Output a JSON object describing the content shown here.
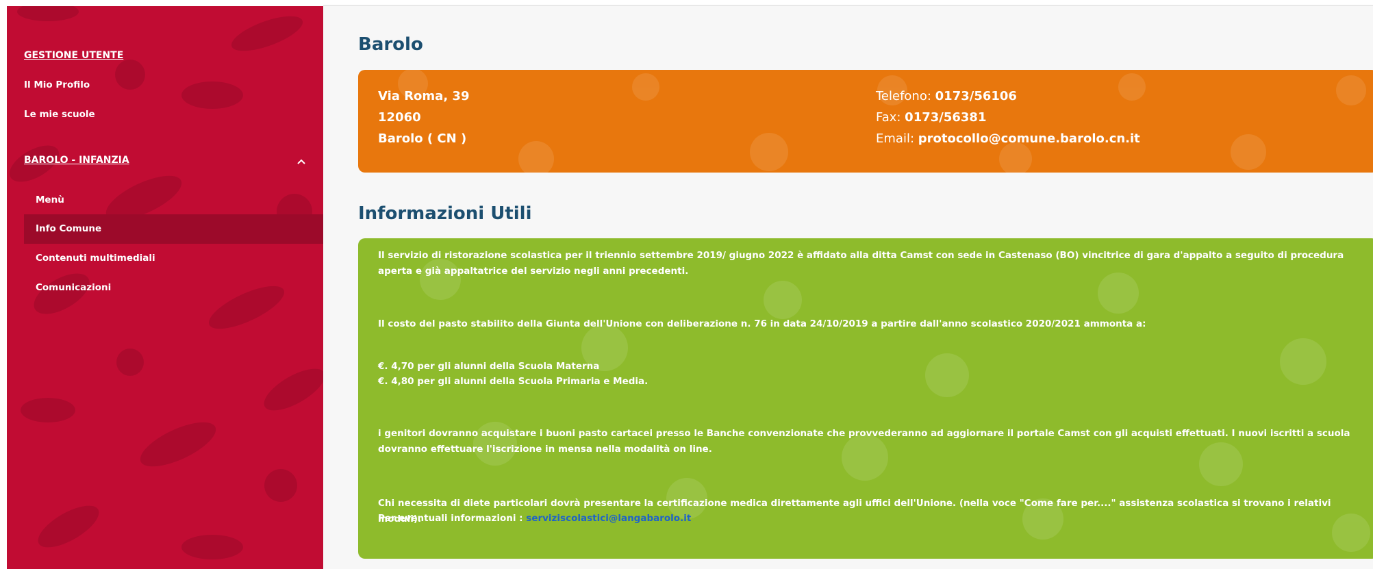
{
  "sidebar": {
    "section_user": "GESTIONE UTENTE",
    "profile": "Il Mio Profilo",
    "schools": "Le mie scuole",
    "section_school": "BAROLO - INFANZIA",
    "sub_items": [
      {
        "label": "Menù"
      },
      {
        "label": "Info Comune"
      },
      {
        "label": "Contenuti multimediali"
      },
      {
        "label": "Comunicazioni"
      }
    ]
  },
  "town": {
    "title": "Barolo",
    "street": "Via Roma, 39",
    "zip": "12060",
    "city": "Barolo ( CN )",
    "phone_label": "Telefono: ",
    "phone": "0173/56106",
    "fax_label": "Fax: ",
    "fax": "0173/56381",
    "email_label": "Email: ",
    "email": "protocollo@comune.barolo.cn.it"
  },
  "info": {
    "title": "Informazioni Utili",
    "p1": "Il servizio di ristorazione scolastica per il triennio settembre 2019/ giugno 2022 è  affidato alla ditta  Camst con sede in Castenaso (BO) vincitrice di gara d'appalto a seguito di procedura aperta e già appaltatrice del servizio negli anni precedenti.",
    "p2": "Il costo del pasto stabilito della Giunta dell'Unione con deliberazione n. 76 in data 24/10/2019 a partire dall'anno scolastico 2020/2021 ammonta  a:",
    "p3a": "€. 4,70 per gli alunni della Scuola Materna",
    "p3b": "€. 4,80 per gli alunni della Scuola Primaria e Media.",
    "p4": "i genitori dovranno acquistare i buoni pasto cartacei presso le Banche convenzionate che provvederanno ad aggiornare il portale Camst con gli acquisti effettuati.   I nuovi iscritti a scuola dovranno effettuare l'iscrizione in mensa nella modalità on line.",
    "p5": "Chi necessita di diete particolari dovrà presentare la certificazione medica direttamente agli uffici dell'Unione. (nella voce  \"Come fare per....\" assistenza scolastica si trovano i relativi moduli).",
    "p6_prefix": "Per eventuali informazioni : ",
    "p6_email": "serviziscolastici@langabarolo.it"
  },
  "colors": {
    "sidebar": "#c10c33",
    "sidebar_active": "#9c0a2a",
    "address_box": "#e8770d",
    "info_box": "#8ebb2c",
    "heading": "#1c4f70",
    "link": "#1e63c9"
  }
}
